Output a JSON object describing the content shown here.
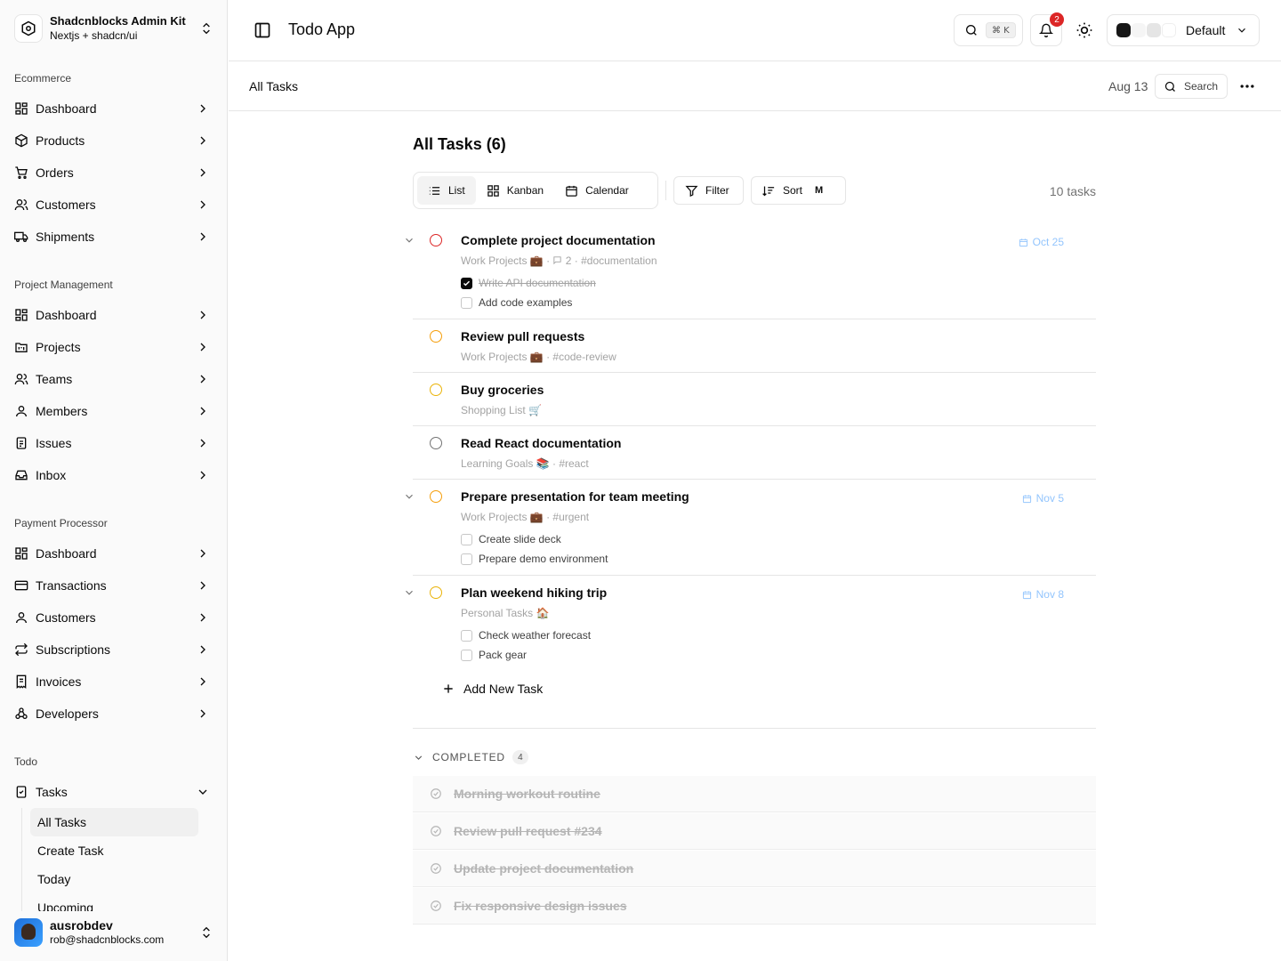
{
  "brand": {
    "name": "Shadcnblocks Admin Kit",
    "subtitle": "Nextjs + shadcn/ui"
  },
  "sidebar": {
    "groups": [
      {
        "label": "Ecommerce",
        "items": [
          "Dashboard",
          "Products",
          "Orders",
          "Customers",
          "Shipments"
        ]
      },
      {
        "label": "Project Management",
        "items": [
          "Dashboard",
          "Projects",
          "Teams",
          "Members",
          "Issues",
          "Inbox"
        ]
      },
      {
        "label": "Payment Processor",
        "items": [
          "Dashboard",
          "Transactions",
          "Customers",
          "Subscriptions",
          "Invoices",
          "Developers"
        ]
      },
      {
        "label": "Todo",
        "items": [
          "Tasks"
        ],
        "sub_items": [
          "All Tasks",
          "Create Task",
          "Today",
          "Upcoming"
        ]
      }
    ]
  },
  "user": {
    "name": "ausrobdev",
    "email": "rob@shadcnblocks.com"
  },
  "header": {
    "title": "Todo App",
    "search_shortcut": "⌘ K",
    "notification_count": "2",
    "theme_label": "Default",
    "theme_swatches": [
      "#171717",
      "#f5f5f5",
      "#e5e5e5",
      "#ffffff"
    ]
  },
  "subheader": {
    "breadcrumb": "All Tasks",
    "date": "Aug 13",
    "search_label": "Search"
  },
  "main": {
    "title": "All Tasks (6)",
    "views": [
      "List",
      "Kanban",
      "Calendar"
    ],
    "filter_label": "Filter",
    "sort_label": "Sort",
    "sort_key": "M",
    "task_count": "10 tasks",
    "tasks": [
      {
        "title": "Complete project documentation",
        "meta": "Work Projects 💼 · ",
        "comments": "2",
        "tag": " · #documentation",
        "due": "Oct 25",
        "priority_color": "#dc2626",
        "subtasks": [
          {
            "text": "Write API documentation",
            "done": true
          },
          {
            "text": "Add code examples",
            "done": false
          }
        ]
      },
      {
        "title": "Review pull requests",
        "meta": "Work Projects 💼 · #code-review",
        "priority_color": "#f59e0b"
      },
      {
        "title": "Buy groceries",
        "meta": "Shopping List 🛒",
        "priority_color": "#eab308"
      },
      {
        "title": "Read React documentation",
        "meta": "Learning Goals 📚 · #react",
        "priority_color": "#737373"
      },
      {
        "title": "Prepare presentation for team meeting",
        "meta": "Work Projects 💼 · #urgent",
        "due": "Nov 5",
        "priority_color": "#f59e0b",
        "subtasks": [
          {
            "text": "Create slide deck",
            "done": false
          },
          {
            "text": "Prepare demo environment",
            "done": false
          }
        ]
      },
      {
        "title": "Plan weekend hiking trip",
        "meta": "Personal Tasks 🏠",
        "due": "Nov 8",
        "priority_color": "#eab308",
        "subtasks": [
          {
            "text": "Check weather forecast",
            "done": false
          },
          {
            "text": "Pack gear",
            "done": false
          }
        ]
      }
    ],
    "add_task_label": "Add New Task",
    "completed_label": "COMPLETED",
    "completed_count": "4",
    "completed": [
      "Morning workout routine",
      "Review pull request #234",
      "Update project documentation",
      "Fix responsive design issues"
    ]
  }
}
